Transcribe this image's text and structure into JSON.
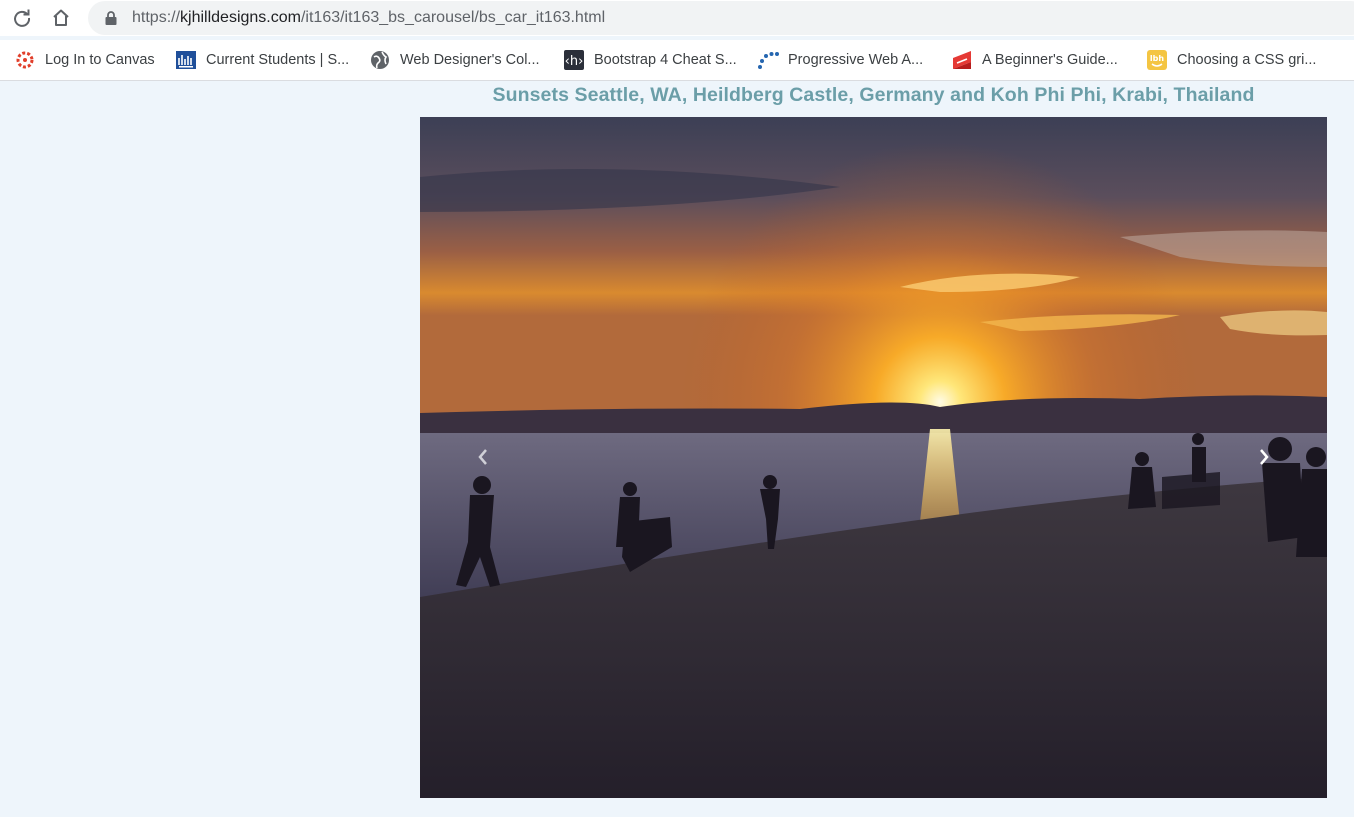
{
  "browser": {
    "url_scheme": "https://",
    "url_host": "kjhilldesigns.com",
    "url_path": "/it163/it163_bs_carousel/bs_car_it163.html",
    "bookmarks": [
      {
        "label": "Log In to Canvas",
        "icon": "canvas-icon"
      },
      {
        "label": "Current Students | S...",
        "icon": "college-icon"
      },
      {
        "label": "Web Designer's Col...",
        "icon": "globe-icon"
      },
      {
        "label": "Bootstrap 4 Cheat S...",
        "icon": "h-icon"
      },
      {
        "label": "Progressive Web A...",
        "icon": "dots-icon"
      },
      {
        "label": "A Beginner's Guide...",
        "icon": "scotch-icon"
      },
      {
        "label": "Choosing a CSS gri...",
        "icon": "lbh-icon"
      }
    ]
  },
  "page": {
    "heading": "Sunsets Seattle, WA, Heildberg Castle, Germany and Koh Phi Phi, Krabi, Thailand",
    "heading_color": "#6b9ea8",
    "background": "#eef5fb"
  },
  "carousel": {
    "slide_description_icon": "sunset-beach-image",
    "prev_icon": "chevron-left-icon",
    "next_icon": "chevron-right-icon"
  }
}
